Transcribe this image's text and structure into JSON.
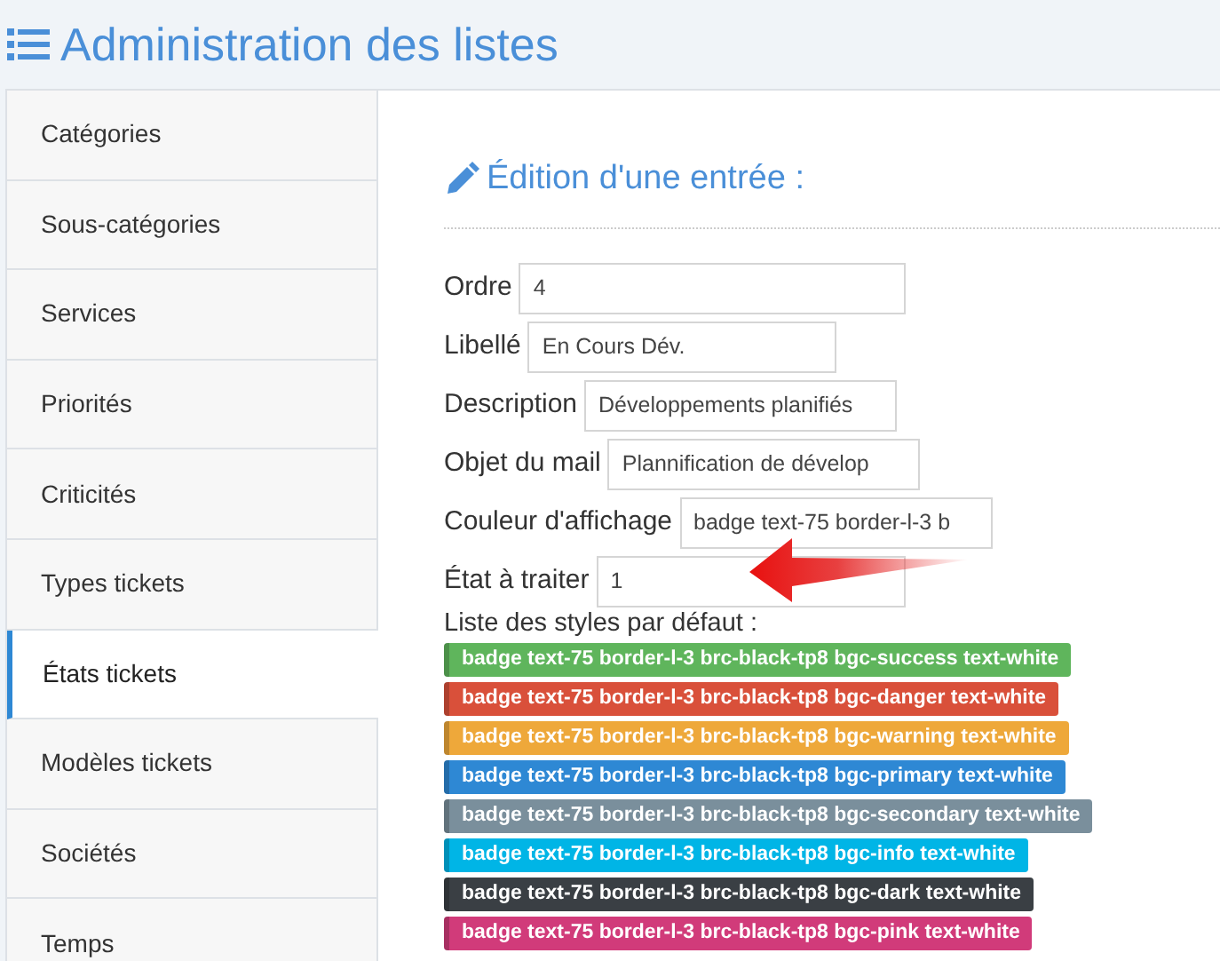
{
  "page_title": "Administration des listes",
  "sidebar": {
    "items": [
      {
        "label": "Catégories",
        "selected": false
      },
      {
        "label": "Sous-catégories",
        "selected": false
      },
      {
        "label": "Services",
        "selected": false
      },
      {
        "label": "Priorités",
        "selected": false
      },
      {
        "label": "Criticités",
        "selected": false
      },
      {
        "label": "Types tickets",
        "selected": false
      },
      {
        "label": "États tickets",
        "selected": true
      },
      {
        "label": "Modèles tickets",
        "selected": false
      },
      {
        "label": "Sociétés",
        "selected": false
      },
      {
        "label": "Temps",
        "selected": false
      }
    ]
  },
  "form": {
    "heading": "Édition d'une entrée :",
    "fields": [
      {
        "label": "Ordre",
        "value": "4"
      },
      {
        "label": "Libellé",
        "value": "En Cours Dév."
      },
      {
        "label": "Description",
        "value": "Développements planifiés"
      },
      {
        "label": "Objet du mail",
        "value": "Plannification de dévelop"
      },
      {
        "label": "Couleur d'affichage",
        "value": "badge text-75 border-l-3 b"
      },
      {
        "label": "État à traiter",
        "value": "1"
      }
    ],
    "styles_label": "Liste des styles par défaut :",
    "styles": [
      {
        "text": "badge text-75 border-l-3 brc-black-tp8 bgc-success text-white",
        "color": "#5fb55c"
      },
      {
        "text": "badge text-75 border-l-3 brc-black-tp8 bgc-danger text-white",
        "color": "#d9503a"
      },
      {
        "text": "badge text-75 border-l-3 brc-black-tp8 bgc-warning text-white",
        "color": "#eea83a"
      },
      {
        "text": "badge text-75 border-l-3 brc-black-tp8 bgc-primary text-white",
        "color": "#2e88d4"
      },
      {
        "text": "badge text-75 border-l-3 brc-black-tp8 bgc-secondary text-white",
        "color": "#7a8f9c"
      },
      {
        "text": "badge text-75 border-l-3 brc-black-tp8 bgc-info text-white",
        "color": "#00b5e6"
      },
      {
        "text": "badge text-75 border-l-3 brc-black-tp8 bgc-dark text-white",
        "color": "#3a3f44"
      },
      {
        "text": "badge text-75 border-l-3 brc-black-tp8 bgc-pink text-white",
        "color": "#d13b7a"
      }
    ]
  }
}
